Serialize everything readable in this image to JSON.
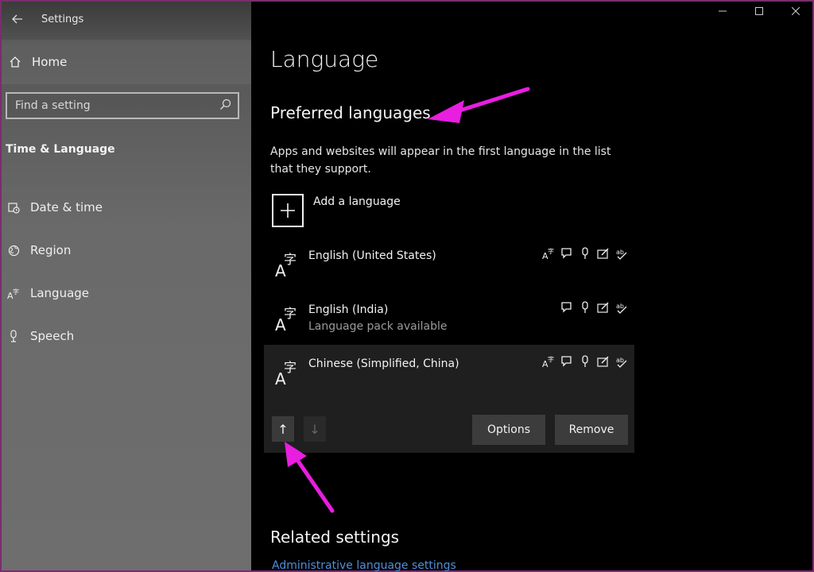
{
  "window": {
    "app_title": "Settings",
    "controls": [
      "—",
      "☐",
      "✕"
    ]
  },
  "sidebar": {
    "home_label": "Home",
    "search_placeholder": "Find a setting",
    "section_title": "Time & Language",
    "items": [
      {
        "label": "Date & time",
        "icon": "calendar-clock-icon"
      },
      {
        "label": "Region",
        "icon": "globe-icon"
      },
      {
        "label": "Language",
        "icon": "language-icon"
      },
      {
        "label": "Speech",
        "icon": "microphone-icon"
      }
    ]
  },
  "main": {
    "page_title": "Language",
    "preferred_title": "Preferred languages",
    "description": "Apps and websites will appear in the first language in the list that they support.",
    "add_language_label": "Add a language",
    "languages": [
      {
        "name": "English (United States)",
        "sub": "",
        "features": [
          "display-language-icon",
          "speech-bubble-icon",
          "microphone-icon",
          "handwriting-icon",
          "spellcheck-icon"
        ]
      },
      {
        "name": "English (India)",
        "sub": "Language pack available",
        "features": [
          "speech-bubble-icon",
          "microphone-icon",
          "handwriting-icon",
          "spellcheck-icon"
        ]
      },
      {
        "name": "Chinese (Simplified, China)",
        "sub": "",
        "features": [
          "display-language-icon",
          "speech-bubble-icon",
          "microphone-icon",
          "handwriting-icon",
          "spellcheck-icon"
        ]
      }
    ],
    "selected_controls": {
      "move_up": "↑",
      "move_down": "↓",
      "options_label": "Options",
      "remove_label": "Remove"
    },
    "related_title": "Related settings",
    "admin_link": "Administrative language settings"
  },
  "colors": {
    "annotation": "#e81ee0",
    "sidebar": "#666666",
    "link": "#4f8fd8"
  }
}
